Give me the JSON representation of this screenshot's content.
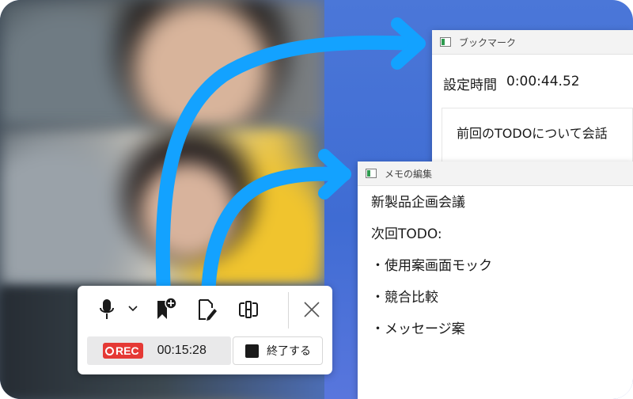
{
  "toolbar": {
    "icons": {
      "mic": "microphone-icon",
      "chevron": "chevron-down-icon",
      "bookmark_add": "bookmark-add-icon",
      "memo_edit": "memo-edit-icon",
      "screen_capture": "screen-capture-icon",
      "close": "close-icon"
    },
    "rec_label": "REC",
    "elapsed": "00:15:28",
    "end_label": "終了する"
  },
  "bookmark_window": {
    "title": "ブックマーク",
    "time_label": "設定時間",
    "time_value": "0:00:44.52",
    "note": "前回のTODOについて会話"
  },
  "memo_window": {
    "title": "メモの編集",
    "lines": [
      "新製品企画会議",
      "次回TODO:",
      "・使用案画面モック",
      "・競合比較",
      "・メッセージ案"
    ]
  },
  "colors": {
    "background_blue": "#3f6cd3",
    "arrow": "#13a2ff",
    "rec_red": "#e53935"
  }
}
